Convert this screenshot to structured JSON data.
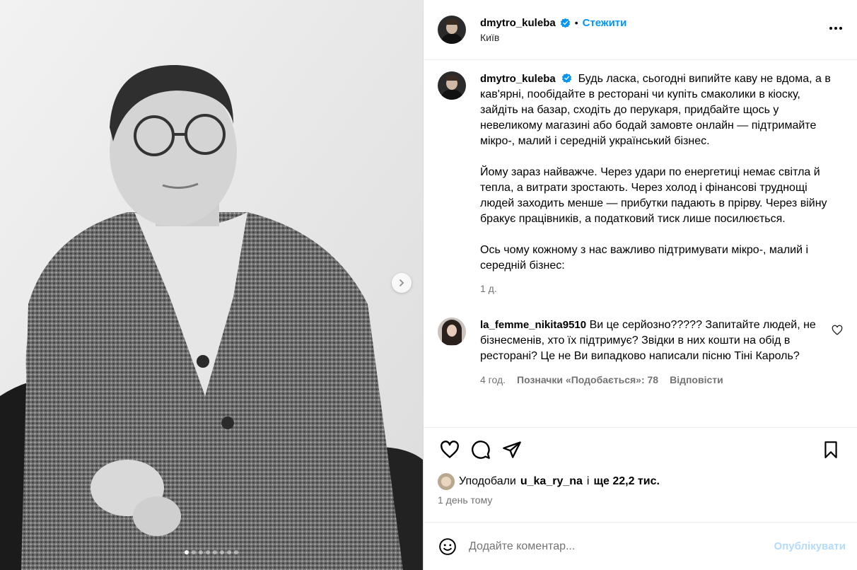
{
  "post": {
    "author": "dmytro_kuleba",
    "bullet": "•",
    "follow_label": "Стежити",
    "location": "Київ",
    "caption_author": "dmytro_kuleba",
    "caption_p1": "Будь ласка, сьогодні випийте каву не вдома, а в кав'ярні, пообідайте в ресторані чи купіть смаколики в кіоску, зайдіть на базар, сходіть до перукаря, придбайте щось у невеликому магазині або бодай замовте онлайн — підтримайте мікро-, малий і середній український бізнес.",
    "caption_p2": "Йому зараз найважче. Через удари по енергетиці немає світла й тепла, а витрати зростають. Через холод і фінансові труднощі людей заходить менше — прибутки падають в прірву. Через війну бракує працівників, а податковий тиск лише посилюється.",
    "caption_p3": "Ось чому кожному з нас важливо підтримувати мікро-, малий і середній бізнес:",
    "caption_time": "1 д."
  },
  "comment": {
    "author": "la_femme_nikita9510",
    "text": "Ви це серйозно????? Запитайте людей, не бізнесменів, хто їх підтримує? Звідки в них кошти на обід в ресторані? Це не Ви випадково написали пісню Тіні Кароль?",
    "time": "4 год.",
    "likes": "Позначки «Подобається»: 78",
    "reply": "Відповісти"
  },
  "likes": {
    "prefix": "Уподобали",
    "user": "u_ka_ry_na",
    "conj": "і",
    "rest": "ще 22,2 тис."
  },
  "posted_ago": "1 день тому",
  "add_comment": {
    "placeholder": "Додайте коментар...",
    "publish_label": "Опублікувати"
  },
  "carousel": {
    "total_slides": 8,
    "active_index": 0
  },
  "colors": {
    "accent": "#0095f6",
    "publish_disabled": "#b3dbff",
    "secondary_text": "#737373",
    "verified": "#0095f6"
  },
  "icons": [
    "verified-badge-icon",
    "more-options-icon",
    "chevron-right-icon",
    "heart-icon",
    "comment-icon",
    "share-icon",
    "bookmark-icon",
    "emoji-icon",
    "comment-like-icon"
  ]
}
